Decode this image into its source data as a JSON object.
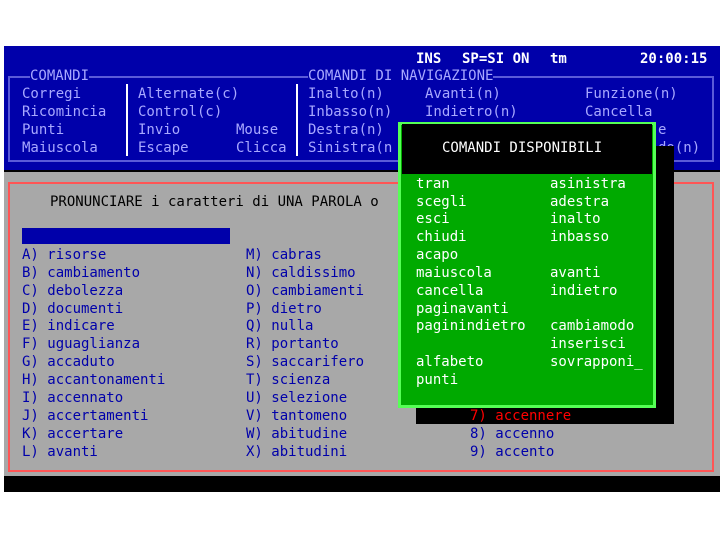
{
  "status_bar": {
    "mode": "INS",
    "speech": "SP=SI ON",
    "label": "tm",
    "clock": "20:00:15"
  },
  "commands": {
    "title": "COMANDI",
    "col1": [
      "Corregi",
      "Ricomincia",
      "Punti",
      "Maiuscola"
    ],
    "col2": [
      "Alternate(c)",
      "Control(c)",
      "Invio",
      "Escape"
    ],
    "col3": [
      "",
      "",
      "Mouse",
      "Clicca"
    ],
    "nav_title": "COMANDI DI NAVIGAZIONE",
    "nav1": [
      "Inalto(n)",
      "Inbasso(n)",
      "Destra(n)",
      "Sinistra(n"
    ],
    "nav2": [
      "Avanti(n)",
      "Indietro(n)"
    ],
    "col5": [
      "Funzione(n)",
      "Cancella"
    ],
    "col5_partial": [
      "e",
      "do(n)"
    ]
  },
  "main": {
    "instruction": "PRONUNCIARE i caratteri di UNA PAROLA o",
    "left_words": [
      "A) risorse",
      "B) cambiamento",
      "C) debolezza",
      "D) documenti",
      "E) indicare",
      "F) uguaglianza",
      "G) accaduto",
      "H) accantonamenti",
      "I) accennato",
      "J) accertamenti",
      "K) accertare",
      "L) avanti"
    ],
    "mid_words": [
      "M) cabras",
      "N) caldissimo",
      "O) cambiamenti",
      "P) dietro",
      "Q) nulla",
      "R) portanto",
      "S) saccarifero",
      "T) scienza",
      "U) selezione",
      "V) tantomeno",
      "W) abitudine",
      "X) abitudini"
    ],
    "right_words": [
      "7) accennere",
      "8) accenno",
      "9) accento"
    ]
  },
  "popup": {
    "title": "COMANDI DISPONIBILI",
    "left_items": [
      "tran",
      "scegli",
      "esci",
      "chiudi",
      "acapo",
      "maiuscola",
      "cancella",
      "paginavanti",
      "paginindietro",
      "",
      "alfabeto",
      "punti"
    ],
    "right_items": [
      "asinistra",
      "adestra",
      "inalto",
      "inbasso",
      "",
      "avanti",
      "indietro",
      "",
      "cambiamodo",
      "inserisci",
      "sovrapponi_",
      ""
    ]
  },
  "colors": {
    "panel_blue": "#0000aa",
    "main_gray": "#a8a8a8",
    "popup_green": "#00aa00",
    "frame_red": "#ff5555"
  }
}
